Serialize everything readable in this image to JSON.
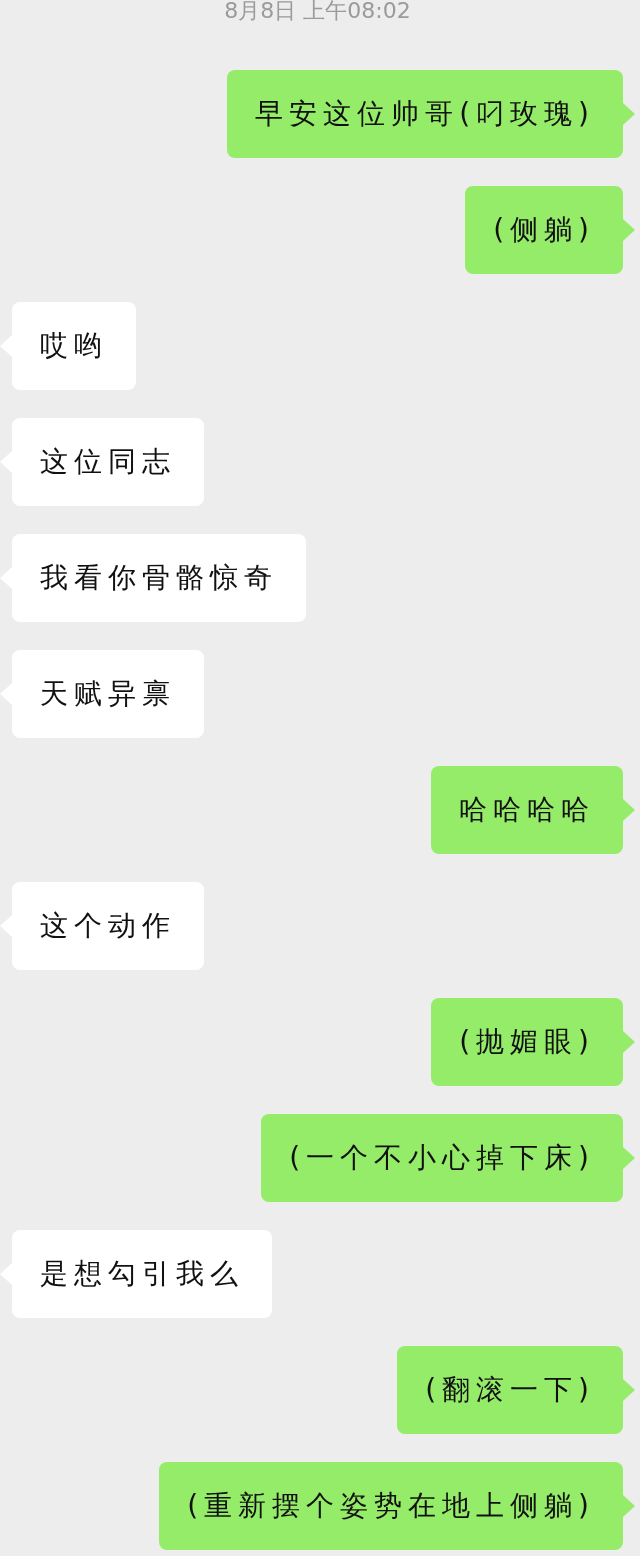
{
  "timestamp": "8月8日 上午08:02",
  "messages": [
    {
      "kind": "sent",
      "text": "早安这位帅哥(叼玫瑰)"
    },
    {
      "kind": "sent",
      "text": "(侧躺)"
    },
    {
      "kind": "received",
      "text": "哎哟"
    },
    {
      "kind": "received",
      "text": "这位同志"
    },
    {
      "kind": "received",
      "text": "我看你骨骼惊奇"
    },
    {
      "kind": "received",
      "text": "天赋异禀"
    },
    {
      "kind": "sent",
      "text": "哈哈哈哈"
    },
    {
      "kind": "received",
      "text": "这个动作"
    },
    {
      "kind": "sent",
      "text": "(抛媚眼)"
    },
    {
      "kind": "sent",
      "text": "(一个不小心掉下床)"
    },
    {
      "kind": "received",
      "text": "是想勾引我么"
    },
    {
      "kind": "sent",
      "text": "(翻滚一下)"
    },
    {
      "kind": "sent",
      "text": "(重新摆个姿势在地上侧躺)"
    }
  ]
}
